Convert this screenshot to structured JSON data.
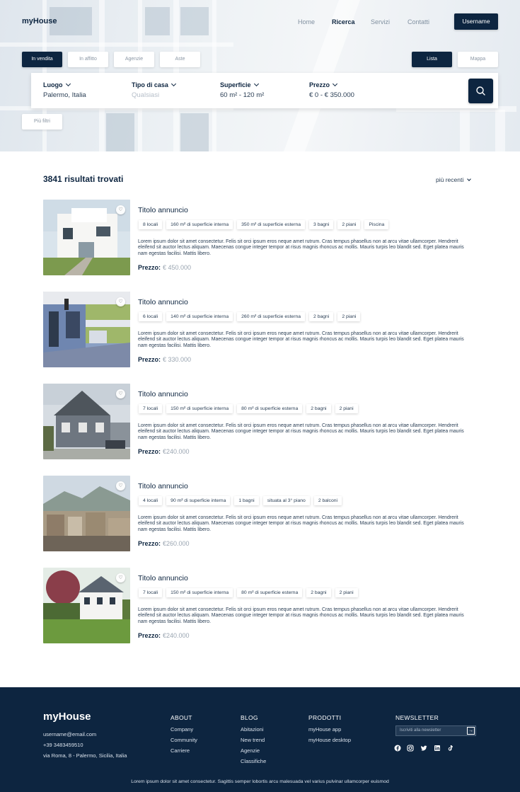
{
  "header": {
    "logo": "myHouse",
    "nav": [
      "Home",
      "Ricerca",
      "Servizi",
      "Contatti"
    ],
    "user_button": "Username"
  },
  "filters": {
    "type_tabs": [
      "In vendita",
      "In affitto",
      "Agenzie",
      "Aste"
    ],
    "view_tabs": [
      "Lista",
      "Mappa"
    ],
    "more_filters": "Più filtri"
  },
  "search": {
    "fields": [
      {
        "label": "Luogo",
        "value": "Palermo, Italia"
      },
      {
        "label": "Tipo di casa",
        "value": "Qualsiasi"
      },
      {
        "label": "Superficie",
        "value": "60 m² - 120 m²"
      },
      {
        "label": "Prezzo",
        "value": "€ 0 - € 350.000"
      }
    ]
  },
  "results": {
    "count_text": "3841 risultati trovati",
    "sort_label": "più recenti"
  },
  "listings": [
    {
      "title": "Titolo annuncio",
      "tags": [
        "8 locali",
        "160 m² di superficie interna",
        "350 m² di superficie esterna",
        "3 bagni",
        "2 piani",
        "Piscina"
      ],
      "description": "Lorem ipsum dolor sit amet consectetur. Felis sit orci ipsum eros neque amet rutrum. Cras tempus phasellus non at arcu vitae ullamcorper. Hendrerit eleifend sit auctor lectus aliquam. Maecenas congue integer tempor at risus magnis rhoncus ac mollis. Mauris turpis leo blandit sed. Eget platea mauris nam egestas facilisi. Mattis libero.",
      "price_label": "Prezzo:",
      "price": "€ 450.000"
    },
    {
      "title": "Titolo annuncio",
      "tags": [
        "6 locali",
        "140 m² di superficie interna",
        "260 m² di superficie esterna",
        "2 bagni",
        "2 piani"
      ],
      "description": "Lorem ipsum dolor sit amet consectetur. Felis sit orci ipsum eros neque amet rutrum. Cras tempus phasellus non at arcu vitae ullamcorper. Hendrerit eleifend sit auctor lectus aliquam. Maecenas congue integer tempor at risus magnis rhoncus ac mollis. Mauris turpis leo blandit sed. Eget platea mauris nam egestas facilisi. Mattis libero.",
      "price_label": "Prezzo:",
      "price": "€ 330.000"
    },
    {
      "title": "Titolo annuncio",
      "tags": [
        "7 locali",
        "150 m² di superficie interna",
        "80 m² di superficie esterna",
        "2 bagni",
        "2 piani"
      ],
      "description": "Lorem ipsum dolor sit amet consectetur. Felis sit orci ipsum eros neque amet rutrum. Cras tempus phasellus non at arcu vitae ullamcorper. Hendrerit eleifend sit auctor lectus aliquam. Maecenas congue integer tempor at risus magnis rhoncus ac mollis. Mauris turpis leo blandit sed. Eget platea mauris nam egestas facilisi. Mattis libero.",
      "price_label": "Prezzo:",
      "price": "€240.000"
    },
    {
      "title": "Titolo annuncio",
      "tags": [
        "4 locali",
        "90 m² di superficie interna",
        "1 bagni",
        "situata al 3° piano",
        "2 balconi"
      ],
      "description": "Lorem ipsum dolor sit amet consectetur. Felis sit orci ipsum eros neque amet rutrum. Cras tempus phasellus non at arcu vitae ullamcorper. Hendrerit eleifend sit auctor lectus aliquam. Maecenas congue integer tempor at risus magnis rhoncus ac mollis. Mauris turpis leo blandit sed. Eget platea mauris nam egestas facilisi. Mattis libero.",
      "price_label": "Prezzo:",
      "price": "€260.000"
    },
    {
      "title": "Titolo annuncio",
      "tags": [
        "7 locali",
        "150 m² di superficie interna",
        "80 m² di superficie esterna",
        "2 bagni",
        "2 piani"
      ],
      "description": "Lorem ipsum dolor sit amet consectetur. Felis sit orci ipsum eros neque amet rutrum. Cras tempus phasellus non at arcu vitae ullamcorper. Hendrerit eleifend sit auctor lectus aliquam. Maecenas congue integer tempor at risus magnis rhoncus ac mollis. Mauris turpis leo blandit sed. Eget platea mauris nam egestas facilisi. Mattis libero.",
      "price_label": "Prezzo:",
      "price": "€240.000"
    }
  ],
  "footer": {
    "logo": "myHouse",
    "email": "username@email.com",
    "phone": "+39 3483459510",
    "address": "via Roma, 8 - Palermo, Sicilia, Italia",
    "about": {
      "heading": "ABOUT",
      "links": [
        "Company",
        "Community",
        "Carriere"
      ]
    },
    "blog": {
      "heading": "BLOG",
      "links": [
        "Abitazioni",
        "New trend",
        "Agenzie",
        "Classifiche"
      ]
    },
    "products": {
      "heading": "PRODOTTI",
      "links": [
        "myHouse app",
        "myHouse desktop"
      ]
    },
    "newsletter": {
      "heading": "NEWSLETTER",
      "placeholder": "Iscriviti alla newsletter"
    },
    "social_icons": [
      "facebook-icon",
      "instagram-icon",
      "twitter-icon",
      "linkedin-icon",
      "tiktok-icon"
    ],
    "copyright": "Lorem ipsum dolor sit amet consectetur. Sagittis semper lobortis arcu malesuada vel varius pulvinar ullamcorper euismod"
  },
  "colors": {
    "primary": "#0d2540",
    "muted": "#9aa5b1"
  }
}
